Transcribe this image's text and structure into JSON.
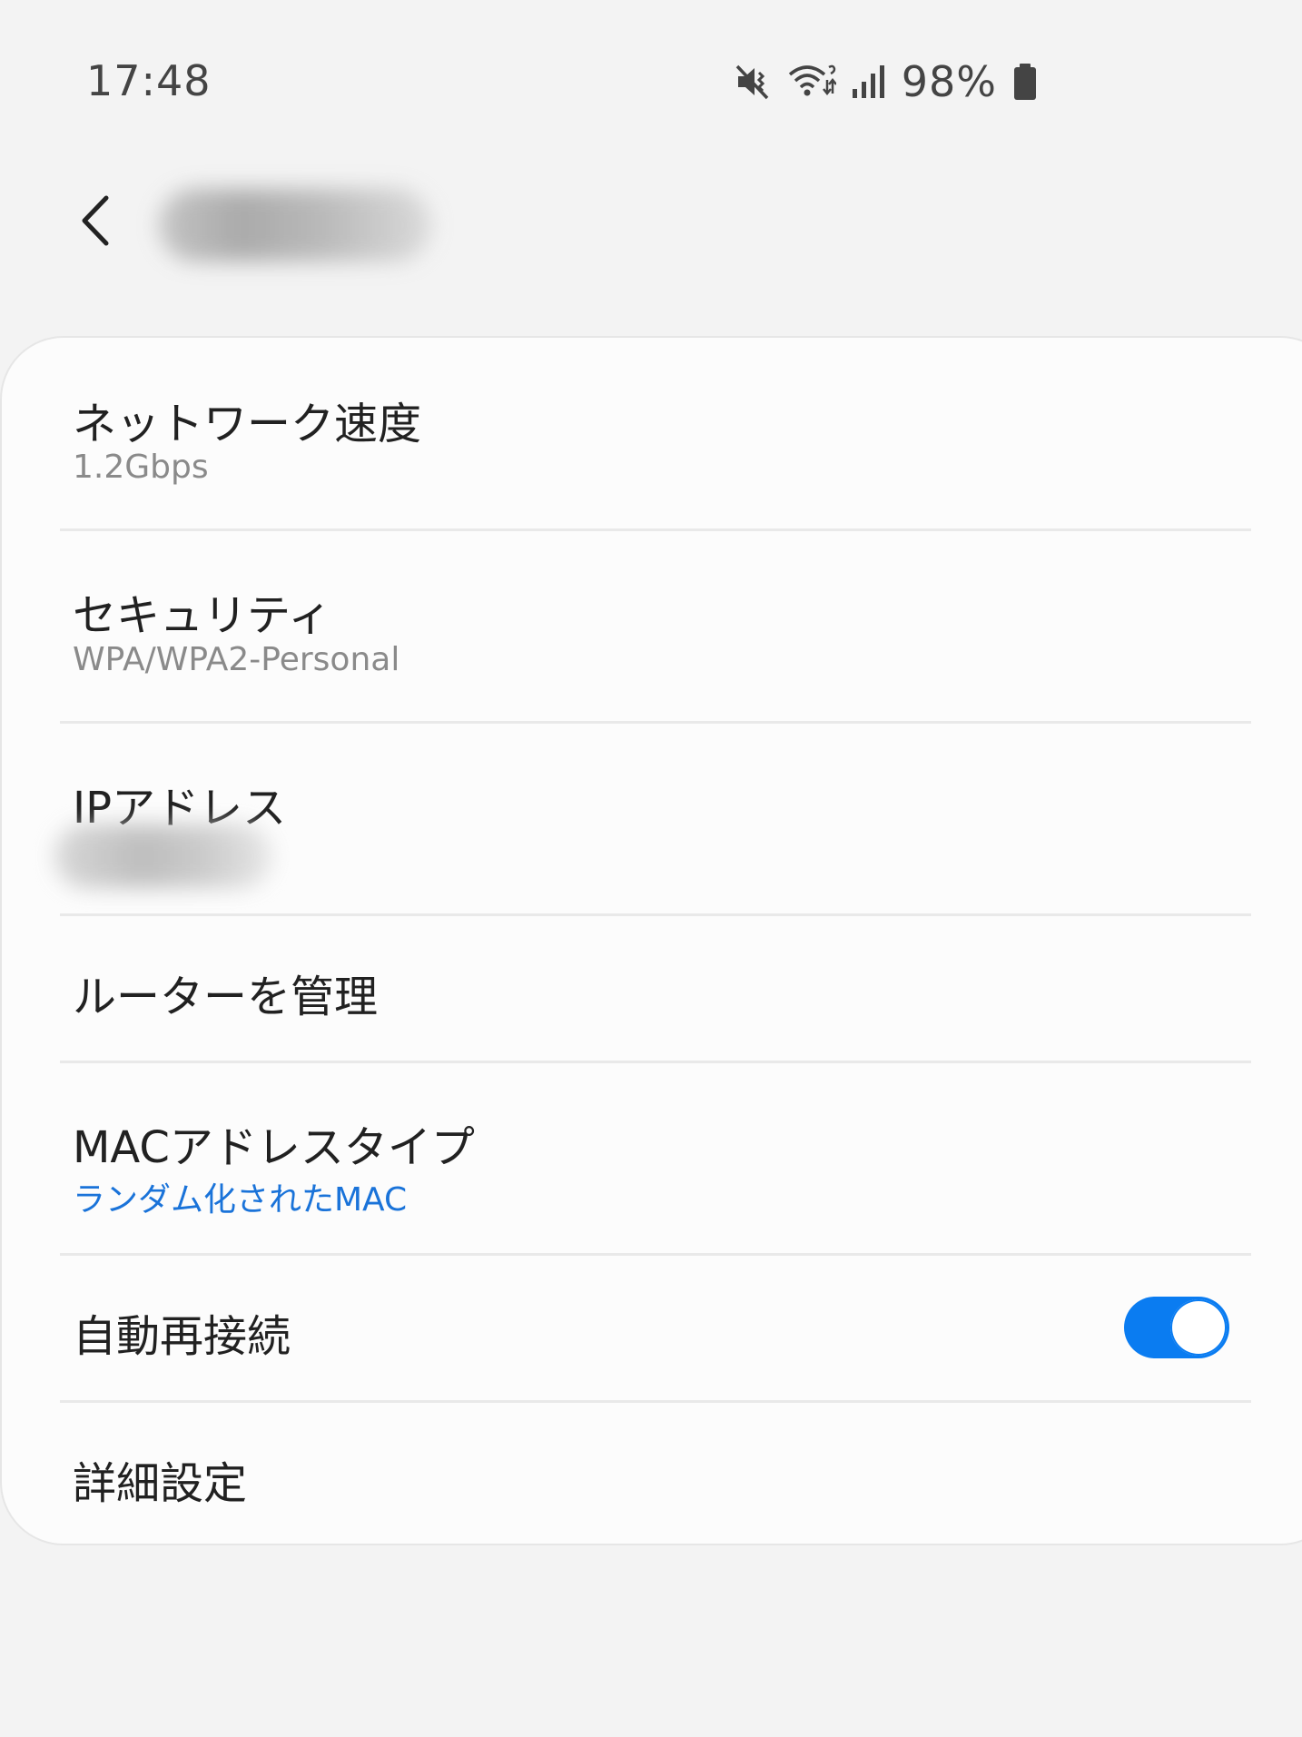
{
  "status_bar": {
    "time": "17:48",
    "battery_percent": "98%",
    "icons": [
      "mute-vibrate-icon",
      "wifi-activity-icon",
      "cellular-signal-icon",
      "battery-icon"
    ]
  },
  "app_bar": {
    "back_icon": "chevron-left-icon",
    "network_name": ""
  },
  "settings": {
    "network_speed": {
      "title": "ネットワーク速度",
      "value": "1.2Gbps"
    },
    "security": {
      "title": "セキュリティ",
      "value": "WPA/WPA2-Personal"
    },
    "ip_address": {
      "title": "IPアドレス",
      "value": ""
    },
    "manage_router": {
      "title": "ルーターを管理"
    },
    "mac_address_type": {
      "title": "MACアドレスタイプ",
      "value": "ランダム化されたMAC"
    },
    "auto_reconnect": {
      "title": "自動再接続",
      "enabled": true
    },
    "advanced": {
      "title": "詳細設定"
    }
  },
  "colors": {
    "accent": "#1a73d9",
    "toggle_on": "#0a7cf1",
    "background": "#f3f3f3",
    "card": "#fcfcfc"
  }
}
